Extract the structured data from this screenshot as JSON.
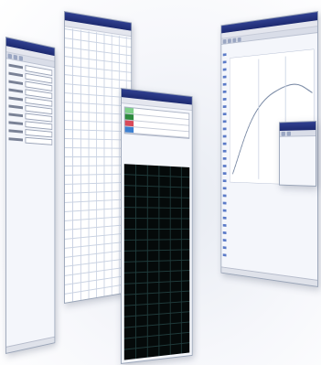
{
  "scene": {
    "description_label": "",
    "accent_color": "#1d2a70",
    "grid_color": "#c9d2e2",
    "dark_panel_color": "#050a0a"
  },
  "windows": [
    {
      "id": "win-1",
      "title": ""
    },
    {
      "id": "win-2",
      "title": ""
    },
    {
      "id": "win-3",
      "title": ""
    },
    {
      "id": "win-4",
      "title": ""
    }
  ],
  "table_chips": [
    "#7fd08a",
    "#2e8a3e",
    "#d94a5a",
    "#3b7fd1"
  ]
}
